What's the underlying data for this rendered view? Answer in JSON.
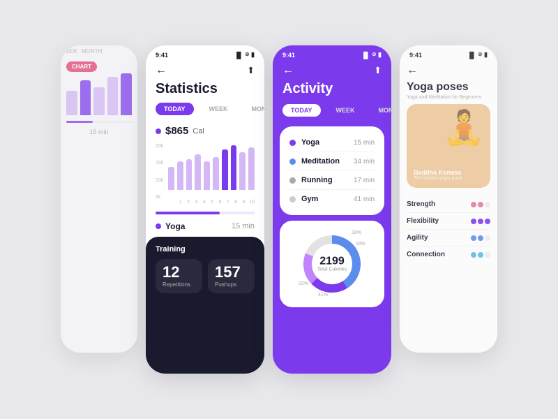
{
  "screens": {
    "screen1": {
      "tabs": [
        "EEK",
        "MONTH"
      ],
      "chart_label": "CHART",
      "time": "15 min"
    },
    "screen2": {
      "status_time": "9:41",
      "title": "Statistics",
      "tabs": [
        "TODAY",
        "WEEK",
        "MONTH"
      ],
      "active_tab": "TODAY",
      "calories": "$865",
      "calories_unit": "Cal",
      "chart": {
        "y_labels": [
          "20k",
          "15k",
          "10k",
          "5k"
        ],
        "x_labels": [
          "1",
          "2",
          "3",
          "4",
          "5",
          "6",
          "7",
          "8",
          "9",
          "10"
        ],
        "bars": [
          45,
          55,
          60,
          70,
          55,
          65,
          80,
          90,
          75,
          85
        ],
        "highlight_index": 7
      },
      "yoga_label": "Yoga",
      "yoga_time": "15 min",
      "training": {
        "title": "Training",
        "cards": [
          {
            "number": "12",
            "label": "Repetitions"
          },
          {
            "number": "157",
            "label": "Pushups"
          }
        ]
      }
    },
    "screen3": {
      "status_time": "9:41",
      "title": "Activity",
      "tabs": [
        "TODAY",
        "WEEK",
        "MONTH"
      ],
      "active_tab": "TODAY",
      "activities": [
        {
          "name": "Yoga",
          "time": "15 min",
          "color": "#7c3aed"
        },
        {
          "name": "Meditation",
          "time": "34 min",
          "color": "#5b8dee"
        },
        {
          "name": "Running",
          "time": "17 min",
          "color": "#aaa"
        },
        {
          "name": "Gym",
          "time": "41 min",
          "color": "#ccc"
        }
      ],
      "donut": {
        "total": "2199",
        "label": "Total Calories",
        "segments": [
          {
            "label": "18%",
            "color": "#c084fc",
            "value": 18
          },
          {
            "label": "22%",
            "color": "#7c3aed",
            "value": 22
          },
          {
            "label": "41%",
            "color": "#5b8dee",
            "value": 41
          },
          {
            "label": "18%",
            "color": "#e2e2e2",
            "value": 18
          }
        ]
      }
    },
    "screen4": {
      "status_time": "9:41",
      "title": "Yoga poses",
      "subtitle": "Yoga and Meditation for Beginners",
      "pose_name": "Baddha Konasa",
      "pose_desc": "The bound angle pose",
      "stats": [
        {
          "name": "Strength",
          "dots": [
            "#e879a0",
            "#e879a0",
            "#ddd"
          ]
        },
        {
          "name": "Flexibility",
          "dots": [
            "#7c3aed",
            "#7c3aed",
            "#7c3aed"
          ]
        },
        {
          "name": "Agility",
          "dots": [
            "#5b8dee",
            "#5b8dee",
            "#ddd"
          ]
        },
        {
          "name": "Connection",
          "dots": [
            "#5bbde8",
            "#5bbde8",
            "#ddd"
          ]
        }
      ]
    }
  }
}
